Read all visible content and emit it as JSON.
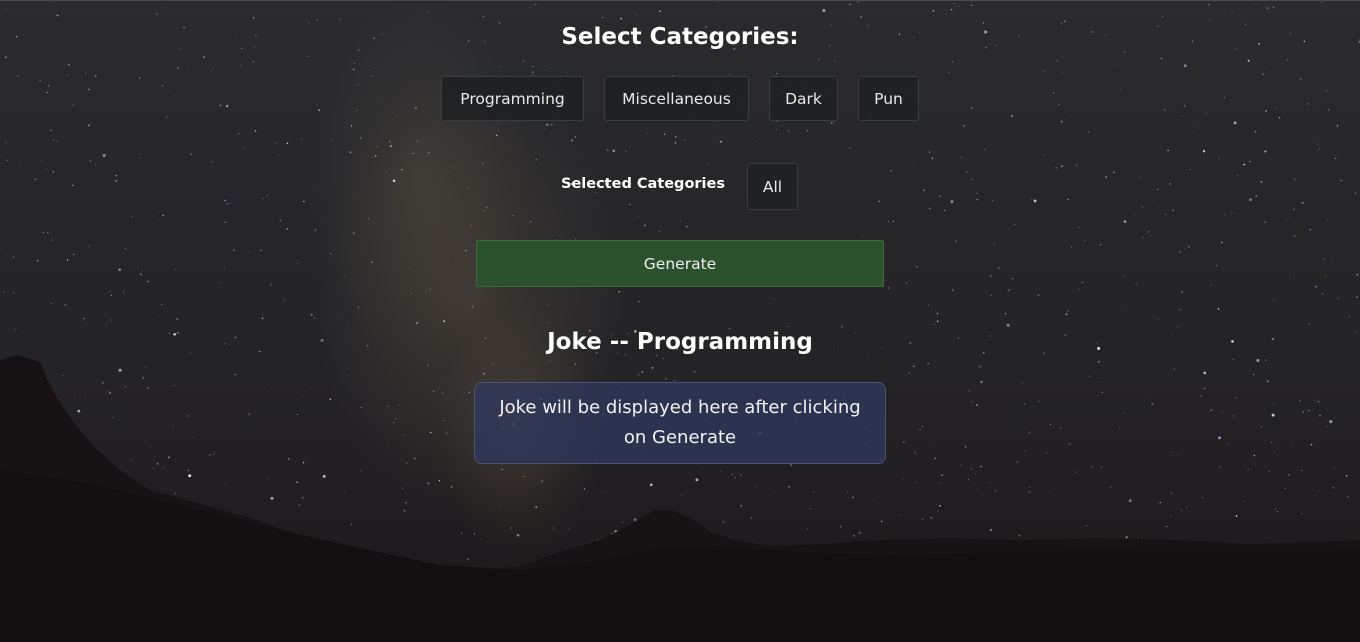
{
  "page": {
    "select_heading": "Select Categories:",
    "categories": [
      "Programming",
      "Miscellaneous",
      "Dark",
      "Pun"
    ],
    "selected_label": "Selected Categories",
    "selected_value": "All",
    "generate_label": "Generate",
    "joke_heading": "Joke -- Programming",
    "joke_placeholder": "Joke will be displayed here after clicking on Generate"
  },
  "colors": {
    "generate_button": "#2b522d",
    "joke_box": "#30385c",
    "chip_background": "#1e2122"
  }
}
